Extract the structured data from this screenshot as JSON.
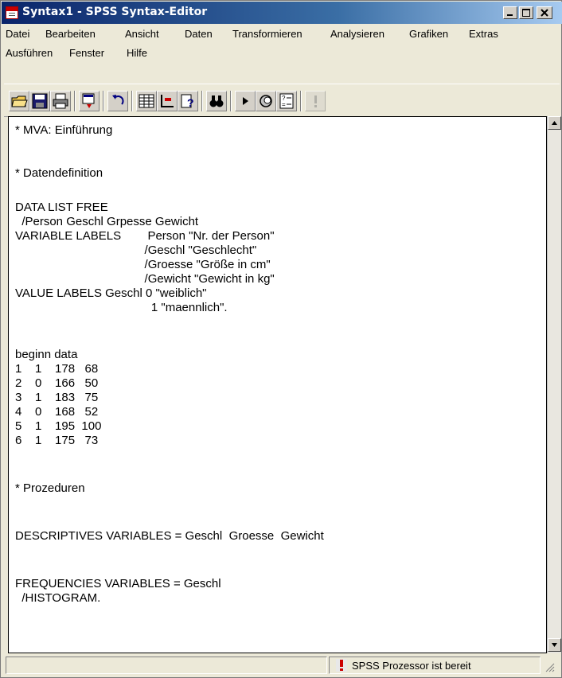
{
  "window": {
    "title": "Syntax1 - SPSS Syntax-Editor"
  },
  "menu": {
    "row1": [
      "Datei",
      "Bearbeiten",
      "Ansicht",
      "Daten",
      "Transformieren",
      "Analysieren",
      "Grafiken",
      "Extras"
    ],
    "row2": [
      "Ausführen",
      "Fenster",
      "Hilfe"
    ]
  },
  "toolbar": {
    "buttons": [
      "open-icon",
      "save-icon",
      "print-icon",
      "dialog-recall-icon",
      "undo-icon",
      "data-editor-icon",
      "goto-case-icon",
      "variables-icon",
      "find-icon",
      "run-icon",
      "use-sets-icon",
      "value-labels-icon",
      "syntax-help-icon"
    ]
  },
  "editor": {
    "lines": [
      "* MVA: Einführung",
      "",
      "* Datendefinition",
      "",
      "DATA LIST FREE",
      "  /Person Geschl Grpesse Gewicht",
      "VARIABLE LABELS        Person \"Nr. der Person\"",
      "                                       /Geschl \"Geschlecht\"",
      "                                       /Groesse \"Größe in cm\"",
      "                                       /Gewicht \"Gewicht in kg\"",
      "VALUE LABELS Geschl 0 \"weiblich\"",
      "                                         1 \"maennlich\".",
      "",
      "beginn data",
      "1    1    178   68",
      "2    0    166   50",
      "3    1    183   75",
      "4    0    168   52",
      "5    1    195  100",
      "6    1    175   73",
      "",
      "* Prozeduren",
      "",
      "DESCRIPTIVES VARIABLES = Geschl  Groesse  Gewicht",
      "",
      "FREQUENCIES VARIABLES = Geschl",
      "  /HISTOGRAM."
    ]
  },
  "status": {
    "text": "SPSS Prozessor  ist bereit"
  }
}
